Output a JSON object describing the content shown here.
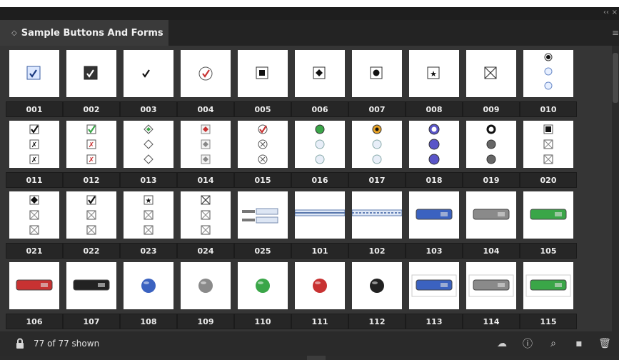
{
  "panel": {
    "title": "Sample Buttons And Forms",
    "status_text": "77 of 77 shown"
  },
  "items": [
    {
      "label": "001",
      "icon": "checkbox-checked-icon"
    },
    {
      "label": "002",
      "icon": "checkbox-filled-checked-icon"
    },
    {
      "label": "003",
      "icon": "checkmark-icon"
    },
    {
      "label": "004",
      "icon": "red-check-circle-icon"
    },
    {
      "label": "005",
      "icon": "filled-square-icon"
    },
    {
      "label": "006",
      "icon": "diamond-in-square-icon"
    },
    {
      "label": "007",
      "icon": "dot-in-square-icon"
    },
    {
      "label": "008",
      "icon": "star-in-square-icon"
    },
    {
      "label": "009",
      "icon": "x-box-icon"
    },
    {
      "label": "010",
      "icon": "radio-stack-icon"
    },
    {
      "label": "011",
      "icon": "checkbox-stack-icon"
    },
    {
      "label": "012",
      "icon": "green-red-checkbox-stack-icon"
    },
    {
      "label": "013",
      "icon": "diamond-stack-icon"
    },
    {
      "label": "014",
      "icon": "red-diamond-stack-icon"
    },
    {
      "label": "015",
      "icon": "circle-check-stack-icon"
    },
    {
      "label": "016",
      "icon": "green-radio-stack-icon"
    },
    {
      "label": "017",
      "icon": "orange-radio-stack-icon"
    },
    {
      "label": "018",
      "icon": "purple-radio-stack-icon"
    },
    {
      "label": "019",
      "icon": "gray-radio-stack-icon"
    },
    {
      "label": "020",
      "icon": "square-box-stack-icon"
    },
    {
      "label": "021",
      "icon": "diamond-box-stack-icon"
    },
    {
      "label": "022",
      "icon": "check-box-stack-icon"
    },
    {
      "label": "023",
      "icon": "star-box-stack-icon"
    },
    {
      "label": "024",
      "icon": "x-box-stack-icon"
    },
    {
      "label": "025",
      "icon": "form-fields-icon"
    },
    {
      "label": "101",
      "icon": "thin-field-icon"
    },
    {
      "label": "102",
      "icon": "thin-field-dotted-icon"
    },
    {
      "label": "103",
      "icon": "blue-button-icon"
    },
    {
      "label": "104",
      "icon": "gray-button-icon"
    },
    {
      "label": "105",
      "icon": "green-button-icon"
    },
    {
      "label": "106",
      "icon": "red-button-icon"
    },
    {
      "label": "107",
      "icon": "black-button-icon"
    },
    {
      "label": "108",
      "icon": "blue-ball-icon"
    },
    {
      "label": "109",
      "icon": "gray-ball-icon"
    },
    {
      "label": "110",
      "icon": "green-ball-icon"
    },
    {
      "label": "111",
      "icon": "red-ball-icon"
    },
    {
      "label": "112",
      "icon": "black-ball-icon"
    },
    {
      "label": "113",
      "icon": "blue-framed-button-icon"
    },
    {
      "label": "114",
      "icon": "gray-framed-button-icon"
    },
    {
      "label": "115",
      "icon": "green-framed-button-icon"
    }
  ],
  "colors": {
    "blue": "#3b62c0",
    "gray": "#8a8a8a",
    "green": "#3aa648",
    "red": "#c83232",
    "black": "#222222",
    "purple": "#5a55c8",
    "orange": "#e6a227"
  }
}
